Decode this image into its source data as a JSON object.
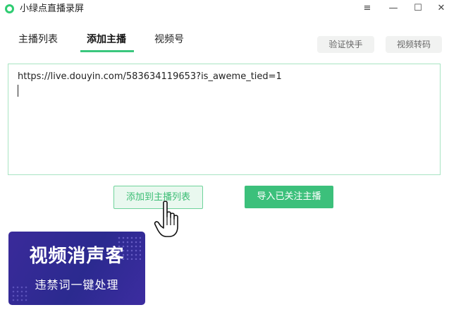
{
  "window": {
    "title": "小绿点直播录屏",
    "controls": {
      "menu": "≡",
      "minimize": "—",
      "maximize": "☐",
      "close": "✕"
    }
  },
  "tabs": [
    {
      "label": "主播列表",
      "active": false
    },
    {
      "label": "添加主播",
      "active": true
    },
    {
      "label": "视频号",
      "active": false
    }
  ],
  "toolbar": {
    "verify_label": "验证快手",
    "convert_label": "视频转码"
  },
  "url_input": {
    "value": "https://live.douyin.com/583634119653?is_aweme_tied=1"
  },
  "actions": {
    "add_to_list_label": "添加到主播列表",
    "import_followed_label": "导入已关注主播"
  },
  "ad": {
    "title": "视频消声客",
    "subtitle": "违禁词一键处理"
  },
  "colors": {
    "accent": "#3cc07b",
    "accent_light": "#e9f8ef",
    "banner": "#2b2a8f"
  },
  "icons": {
    "app": "green-dot-logo",
    "cursor": "hand-pointer-cursor"
  }
}
